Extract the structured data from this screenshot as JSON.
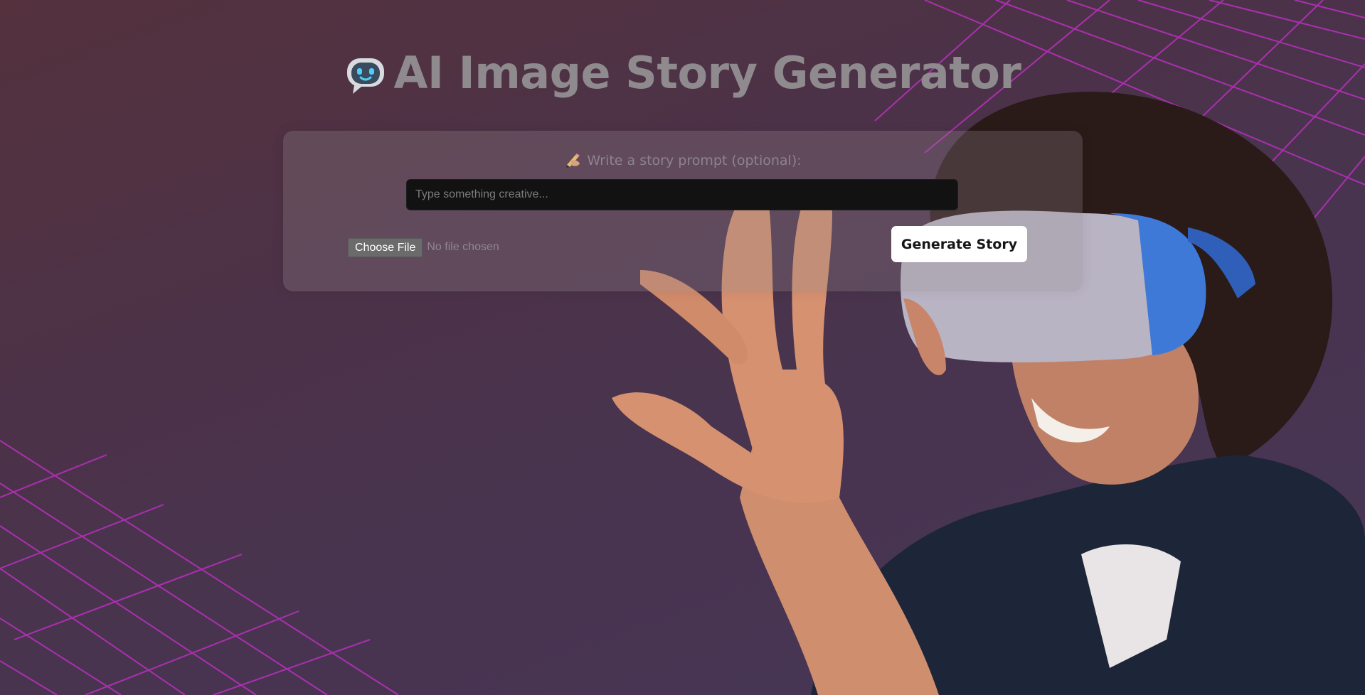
{
  "header": {
    "title": "AI Image Story Generator",
    "icon": "robot-icon"
  },
  "form": {
    "prompt_label": "Write a story prompt (optional):",
    "prompt_icon": "pencil-hand-icon",
    "prompt_value": "",
    "prompt_placeholder": "Type something creative...",
    "choose_file_label": "Choose File",
    "file_status": "No file chosen",
    "generate_label": "Generate Story"
  },
  "background": {
    "image": "woman-vr-headset-hand-image",
    "grid_color": "#c028c8",
    "gradient_start": "#54313d",
    "gradient_end": "#463658"
  },
  "colors": {
    "title": "#8f8a8e",
    "input_bg": "#121212",
    "button_bg": "#ffffff"
  }
}
